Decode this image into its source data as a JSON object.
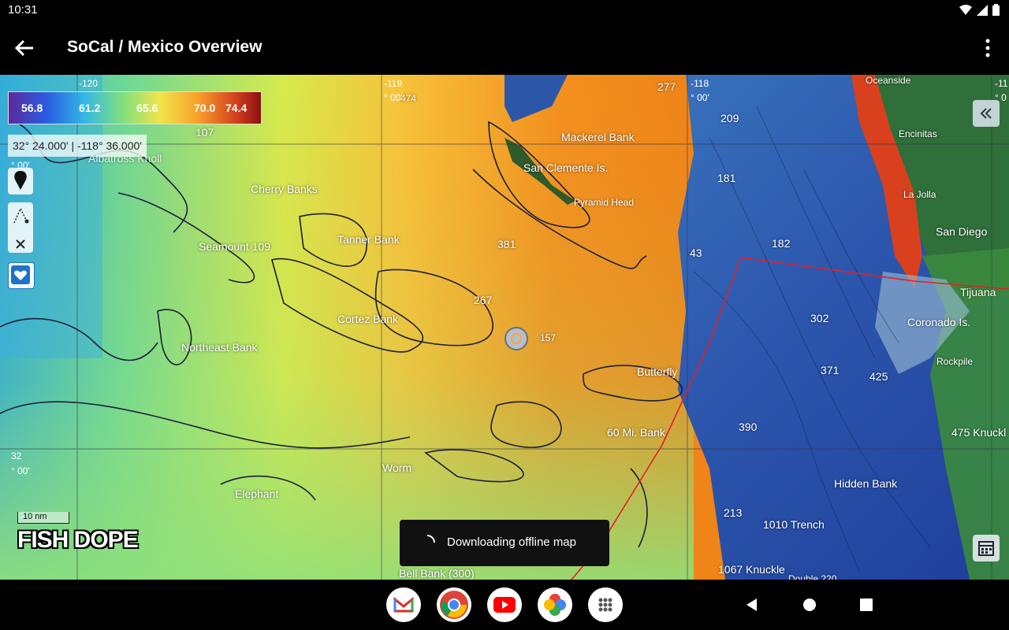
{
  "status": {
    "time": "10:31"
  },
  "appbar": {
    "title": "SoCal / Mexico Overview"
  },
  "legend": {
    "values": [
      "56.8",
      "61.2",
      "65.6",
      "70.0",
      "74.4"
    ]
  },
  "coordinate_readout": "32° 24.000' | -118° 36.000'",
  "grid_labels": {
    "lon_120": "-120",
    "lon_119": "-119",
    "lon_119_min": "° 00'",
    "lon_118": "-118",
    "lon_118_min": "° 00'",
    "lon_right": "-11",
    "lon_right_min": "° 0",
    "lat_33_min": "° 00'",
    "lat_32": "32",
    "lat_32_min": "° 00'"
  },
  "map_labels": {
    "oceanside": "Oceanside",
    "encinitas": "Encinitas",
    "la_jolla": "La Jolla",
    "san_diego": "San Diego",
    "tijuana": "Tijuana",
    "coronado": "Coronado Is.",
    "rockpile": "Rockpile",
    "knuckle_475": "475 Knuckl",
    "hidden_bank": "Hidden Bank",
    "trench_1010": "1010 Trench",
    "knuckle_1067": "1067 Knuckle",
    "double_220": "Double 220",
    "mackerel_bank": "Mackerel Bank",
    "san_clemente": "San Clemente Is.",
    "pyramid_head": "Pyramid Head",
    "albatross_knoll": "Albatross Knoll",
    "cherry_banks": "Cherry Banks",
    "tanner_bank": "Tanner Bank",
    "seamount_109": "Seamount 109",
    "cortez_bank": "Cortez Bank",
    "northeast_bank": "Northeast Bank",
    "butterfly": "Butterfly",
    "sixty_mi_bank": "60 Mi. Bank",
    "worm": "Worm",
    "elephant": "Elephant",
    "bell_bank": "Bell Bank (300)",
    "n_474": "474",
    "n_277": "277",
    "n_209": "209",
    "n_107": "107",
    "n_181": "181",
    "n_182": "182",
    "n_43": "43",
    "n_381": "381",
    "n_267": "267",
    "n_157": "157",
    "n_302": "302",
    "n_371": "371",
    "n_425": "425",
    "n_390": "390",
    "n_213": "213"
  },
  "scale_bar": {
    "label": "10 nm"
  },
  "logo": {
    "text": "FISH DOPE"
  },
  "toast": {
    "message": "Downloading offline map"
  },
  "dock_apps": [
    "gmail-icon",
    "chrome-icon",
    "youtube-icon",
    "photos-icon",
    "app-drawer-icon"
  ],
  "colors": {
    "bar_bg": "#000000",
    "sst_warm": "#f08a1e",
    "sst_cool": "#8be06a",
    "deep_water": "#2f5db0",
    "boundary": "#e0202a"
  }
}
